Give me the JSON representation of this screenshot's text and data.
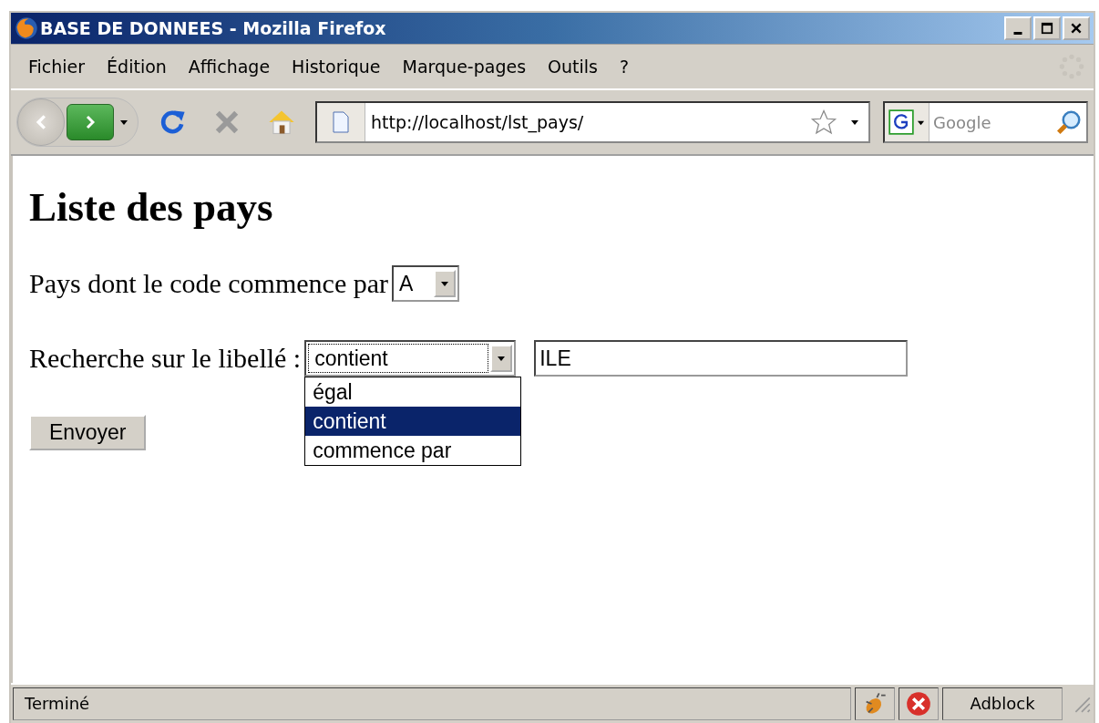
{
  "window": {
    "title": "BASE DE DONNEES - Mozilla Firefox"
  },
  "menu": [
    "Fichier",
    "Édition",
    "Affichage",
    "Historique",
    "Marque-pages",
    "Outils",
    "?"
  ],
  "toolbar": {
    "url": "http://localhost/lst_pays/",
    "search_placeholder": "Google"
  },
  "page": {
    "heading": "Liste des pays",
    "code_filter": {
      "label": "Pays dont le code commence par",
      "value": "A"
    },
    "search": {
      "label": "Recherche sur le libellé :",
      "mode": "contient",
      "expanded": true,
      "text": "ILE",
      "options": [
        {
          "label": "égal",
          "selected": false
        },
        {
          "label": "contient",
          "selected": true
        },
        {
          "label": "commence par",
          "selected": false
        }
      ]
    },
    "submit": "Envoyer"
  },
  "status_bar": {
    "text": "Terminé",
    "addon": "Adblock"
  }
}
